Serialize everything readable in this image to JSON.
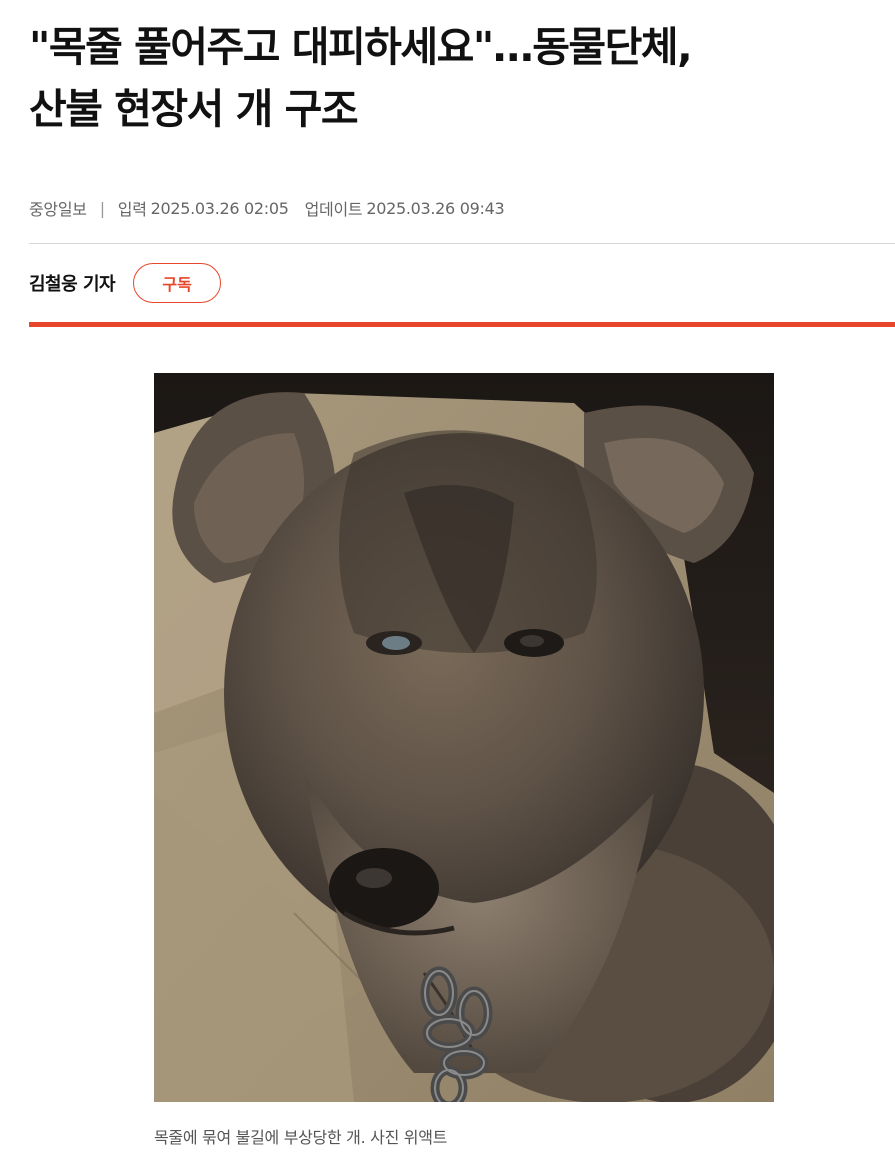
{
  "article": {
    "headline_line1": "\"목줄 풀어주고 대피하세요\"…동물단체,",
    "headline_line2": "산불 현장서 개 구조",
    "source": "중앙일보",
    "published_label": "입력",
    "published_value": "2025.03.26 02:05",
    "updated_label": "업데이트",
    "updated_value": "2025.03.26 09:43",
    "reporter": "김철웅 기자",
    "subscribe_label": "구독",
    "photo": {
      "subject": "dog-with-chain",
      "caption": "목줄에 묶여 불길에 부상당한 개. 사진 위액트"
    }
  },
  "colors": {
    "accent": "#e8462a",
    "text": "#111111",
    "meta_text": "#666666",
    "divider": "#d8d8d8"
  }
}
